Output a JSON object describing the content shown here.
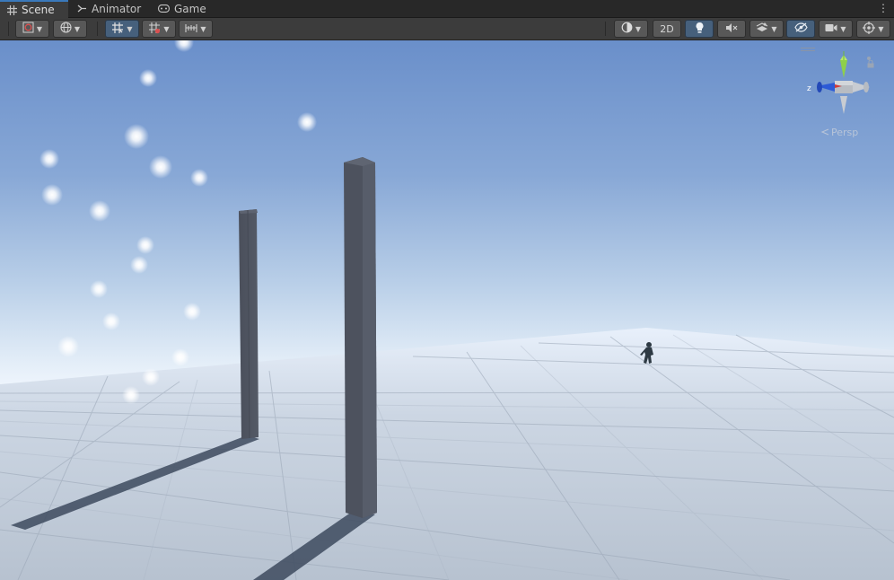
{
  "tabs": [
    {
      "label": "Scene",
      "icon": "grid-icon",
      "active": true
    },
    {
      "label": "Animator",
      "icon": "animator-icon",
      "active": false
    },
    {
      "label": "Game",
      "icon": "gamepad-icon",
      "active": false
    }
  ],
  "toolbar": {
    "draw_mode_icon": "draw-mode-icon",
    "globe_icon": "globe-icon",
    "grid_snap_icon": "grid-snap-icon",
    "increment_snap_icon": "increment-snap-icon",
    "ruler_icon": "ruler-icon",
    "shading_icon": "shading-mode-icon",
    "mode_2d_label": "2D",
    "lighting_icon": "lightbulb-icon",
    "audio_icon": "audio-muted-icon",
    "effects_icon": "effects-icon",
    "visibility_icon": "hidden-eye-icon",
    "camera_icon": "camera-icon",
    "gizmos_icon": "gizmos-icon"
  },
  "gizmo": {
    "z_label": "z",
    "projection_label": "Persp"
  },
  "colors": {
    "sky_top": "#6a8fca",
    "horizon": "#f0f7ff",
    "ground_far": "#6e5e55",
    "plane": "#c9d3df",
    "pillar": "#4b505c",
    "accent": "#3a79bb"
  }
}
